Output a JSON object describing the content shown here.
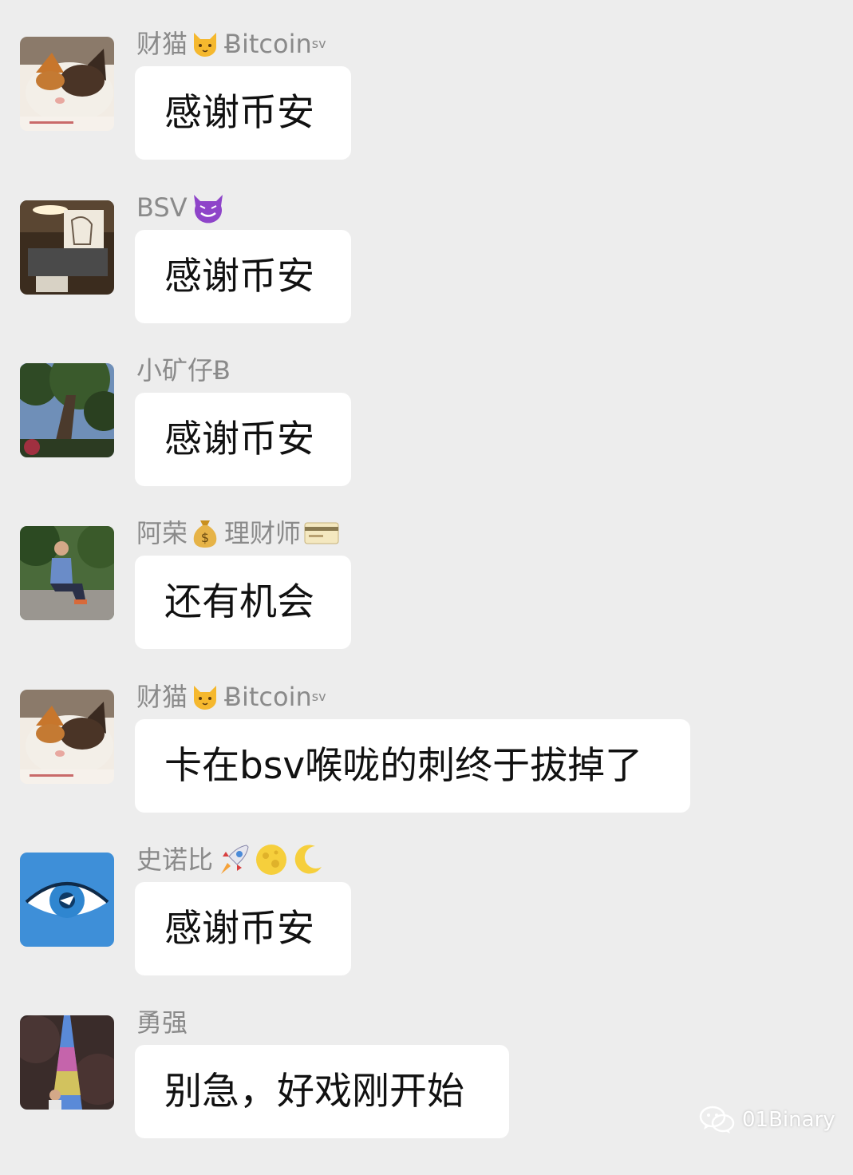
{
  "messages": [
    {
      "avatar": "cat-avatar",
      "sender": {
        "name": "财猫",
        "icons": [
          "cat-face-icon"
        ],
        "suffix": "Ƀitcoin",
        "superscript": "sv"
      },
      "text": "感谢币安"
    },
    {
      "avatar": "desk-lamp-avatar",
      "sender": {
        "name": "BSV",
        "icons": [
          "smiling-devil-icon"
        ],
        "suffix": "",
        "superscript": ""
      },
      "text": "感谢币安"
    },
    {
      "avatar": "tree-avatar",
      "sender": {
        "name": "小矿仔Ƀ",
        "icons": [],
        "suffix": "",
        "superscript": ""
      },
      "text": "感谢币安"
    },
    {
      "avatar": "man-sitting-avatar",
      "sender": {
        "name": "阿荣",
        "icons": [
          "money-bag-icon"
        ],
        "suffix": "理财师",
        "suffix_icons": [
          "credit-card-icon"
        ],
        "superscript": ""
      },
      "text": "还有机会"
    },
    {
      "avatar": "cat-avatar",
      "sender": {
        "name": "财猫",
        "icons": [
          "cat-face-icon"
        ],
        "suffix": "Ƀitcoin",
        "superscript": "sv"
      },
      "text": "卡在bsv喉咙的刺终于拔掉了"
    },
    {
      "avatar": "eye-avatar",
      "sender": {
        "name": "史诺比",
        "icons": [
          "rocket-icon",
          "full-moon-icon",
          "crescent-moon-icon"
        ],
        "suffix": "",
        "superscript": ""
      },
      "text": "感谢币安"
    },
    {
      "avatar": "tower-avatar",
      "sender": {
        "name": "勇强",
        "icons": [],
        "suffix": "",
        "superscript": ""
      },
      "text": "别急，好戏刚开始"
    }
  ],
  "watermark": {
    "text": "01Binary",
    "icon": "wechat-icon"
  },
  "colors": {
    "background": "#ededed",
    "bubble": "#ffffff",
    "sender_text": "#8a8a8a",
    "message_text": "#111111"
  }
}
